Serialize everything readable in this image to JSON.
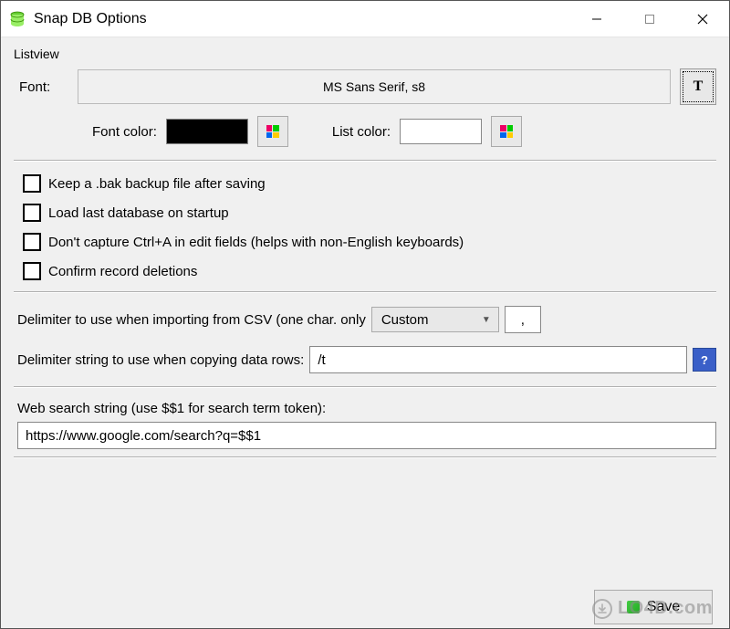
{
  "window": {
    "title": "Snap DB Options"
  },
  "listview": {
    "group_label": "Listview",
    "font_label": "Font:",
    "font_value": "MS Sans Serif, s8",
    "font_picker_glyph": "T",
    "font_color_label": "Font color:",
    "list_color_label": "List color:",
    "font_color": "#000000",
    "list_color": "#FFFFFF"
  },
  "checks": [
    {
      "label": "Keep a .bak backup file after saving",
      "checked": false
    },
    {
      "label": "Load last database on startup",
      "checked": false
    },
    {
      "label": "Don't capture Ctrl+A in edit fields (helps with non-English keyboards)",
      "checked": false
    },
    {
      "label": "Confirm record deletions",
      "checked": false
    }
  ],
  "delimiters": {
    "import_label": "Delimiter to use when importing from CSV (one char. only",
    "import_combo": "Custom",
    "import_char": ",",
    "copy_label": "Delimiter string to use when copying data rows:",
    "copy_value": "/t"
  },
  "websearch": {
    "label": "Web search string (use $$1 for search term token):",
    "value": "https://www.google.com/search?q=$$1"
  },
  "save_button": "Save",
  "watermark": "LO4D.com"
}
